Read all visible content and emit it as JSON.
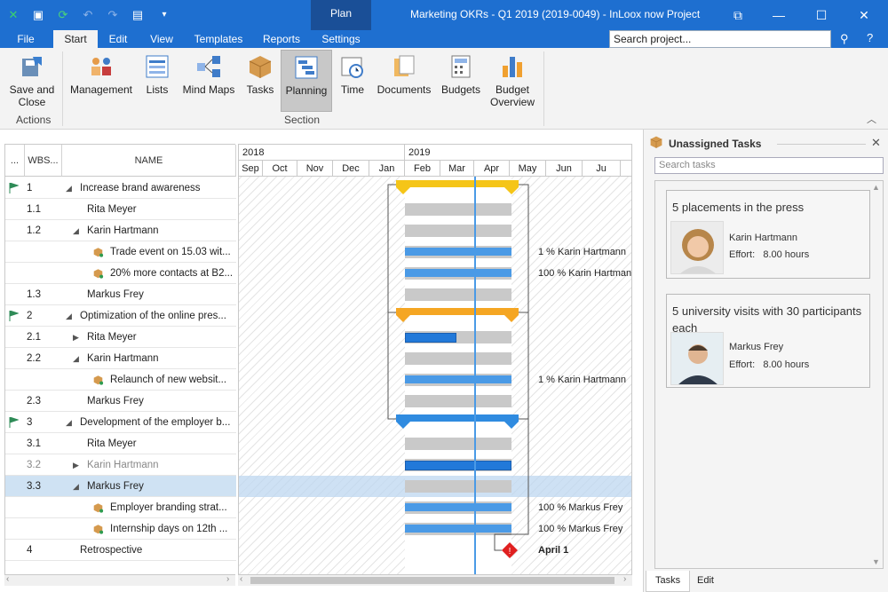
{
  "window": {
    "title": "Marketing OKRs - Q1 2019 (2019-0049) - InLoox now Project",
    "contextual_tab": "Plan",
    "minimize": "—",
    "maximize": "☐",
    "close": "✕",
    "restore": "⧉"
  },
  "quick_access": [
    "✕",
    "💾",
    "⟳",
    "↶",
    "↷",
    "▤",
    "▾"
  ],
  "tabs": [
    "File",
    "Start",
    "Edit",
    "View",
    "Templates",
    "Reports",
    "Settings"
  ],
  "active_tab": "Start",
  "search_project": {
    "placeholder": "Search project..."
  },
  "ribbon": {
    "save_close": {
      "line1": "Save and",
      "line2": "Close"
    },
    "actions_label": "Actions",
    "buttons": [
      "Management",
      "Lists",
      "Mind Maps",
      "Tasks",
      "Planning",
      "Time",
      "Documents",
      "Budgets"
    ],
    "budget_overview": {
      "line1": "Budget",
      "line2": "Overview"
    },
    "section_label": "Section",
    "collapse": "︿"
  },
  "grid": {
    "headers": {
      "more": "...",
      "wbs": "WBS...",
      "name": "NAME"
    },
    "rows": [
      {
        "wbs": "1",
        "name": "Increase brand awareness",
        "flag": true,
        "tri": "◢",
        "level": 0
      },
      {
        "wbs": "1.1",
        "name": "Rita Meyer",
        "level": 1
      },
      {
        "wbs": "1.2",
        "name": "Karin Hartmann",
        "tri": "◢",
        "level": 1
      },
      {
        "wbs": "",
        "name": "Trade event on 15.03 wit...",
        "pkg": true,
        "level": 2
      },
      {
        "wbs": "",
        "name": "20% more contacts at B2...",
        "pkg": true,
        "level": 2
      },
      {
        "wbs": "1.3",
        "name": "Markus Frey",
        "level": 1
      },
      {
        "wbs": "2",
        "name": "Optimization of the online pres...",
        "flag": true,
        "tri": "◢",
        "level": 0
      },
      {
        "wbs": "2.1",
        "name": "Rita Meyer",
        "tri": "▶",
        "level": 1
      },
      {
        "wbs": "2.2",
        "name": "Karin Hartmann",
        "tri": "◢",
        "level": 1
      },
      {
        "wbs": "",
        "name": "Relaunch of new websit...",
        "pkg": true,
        "level": 2
      },
      {
        "wbs": "2.3",
        "name": "Markus Frey",
        "level": 1
      },
      {
        "wbs": "3",
        "name": "Development of the employer b...",
        "flag": true,
        "tri": "◢",
        "level": 0
      },
      {
        "wbs": "3.1",
        "name": "Rita Meyer",
        "level": 1
      },
      {
        "wbs": "3.2",
        "name": "Karin Hartmann",
        "tri": "▶",
        "level": 1,
        "muted": true
      },
      {
        "wbs": "3.3",
        "name": "Markus Frey",
        "tri": "◢",
        "level": 1,
        "selected": true
      },
      {
        "wbs": "",
        "name": "Employer branding strat...",
        "pkg": true,
        "level": 2
      },
      {
        "wbs": "",
        "name": "Internship days on 12th ...",
        "pkg": true,
        "level": 2
      },
      {
        "wbs": "4",
        "name": "Retrospective",
        "level": 0
      }
    ]
  },
  "gantt": {
    "years": [
      "2018",
      "2019"
    ],
    "months": [
      "Sep",
      "Oct",
      "Nov",
      "Dec",
      "Jan",
      "Feb",
      "Mar",
      "Apr",
      "May",
      "Jun",
      "Ju"
    ],
    "labels": {
      "r3": "1 % Karin Hartmann",
      "r4": "100 % Karin Hartmann",
      "r9": "1 % Karin Hartmann",
      "r15": "100 % Markus Frey",
      "r16": "100 % Markus Frey",
      "r17": "April 1"
    },
    "colors": {
      "phase1": "#f5c518",
      "phase2": "#f5a623",
      "phase3": "#2f8be0",
      "milestone": "#e02020",
      "today": "#4a9ae6"
    }
  },
  "panel": {
    "title": "Unassigned Tasks",
    "close": "✕",
    "search_placeholder": "Search tasks",
    "cards": [
      {
        "title": "5 placements in the press",
        "person": "Karin Hartmann",
        "effort_label": "Effort:",
        "effort_value": "8.00 hours"
      },
      {
        "title": "5 university visits with 30 participants each",
        "person": "Markus Frey",
        "effort_label": "Effort:",
        "effort_value": "8.00 hours"
      }
    ],
    "tabs": [
      "Tasks",
      "Edit"
    ]
  }
}
